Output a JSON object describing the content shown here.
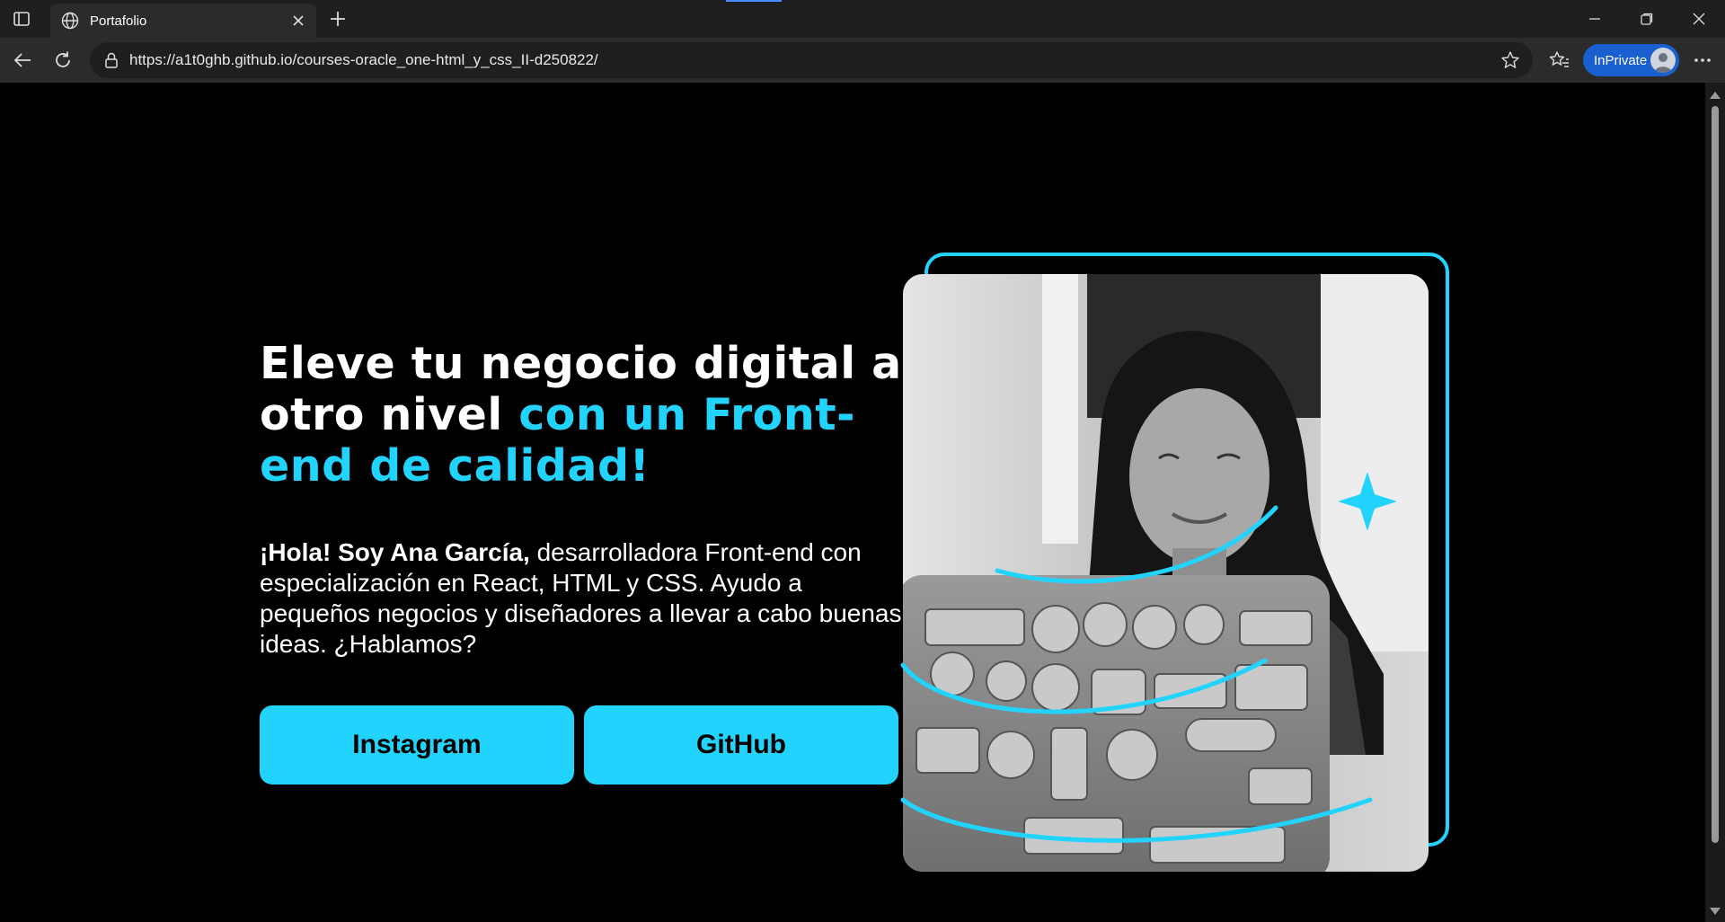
{
  "browser": {
    "tab_title": "Portafolio",
    "url": "https://a1t0ghb.github.io/courses-oracle_one-html_y_css_II-d250822/",
    "inprivate_label": "InPrivate"
  },
  "hero": {
    "headline_white": "Eleve tu negocio digital a otro nivel",
    "headline_accent": "con un Front-end de calidad!",
    "intro_bold": "¡Hola! Soy Ana García,",
    "intro_text": " desarrolladora Front-end con especialización en React, HTML y CSS. Ayudo a pequeños negocios y diseñadores a llevar a cabo buenas ideas. ¿Hablamos?",
    "buttons": {
      "instagram": "Instagram",
      "github": "GitHub"
    }
  },
  "colors": {
    "accent": "#22d4fd",
    "background": "#000000"
  }
}
